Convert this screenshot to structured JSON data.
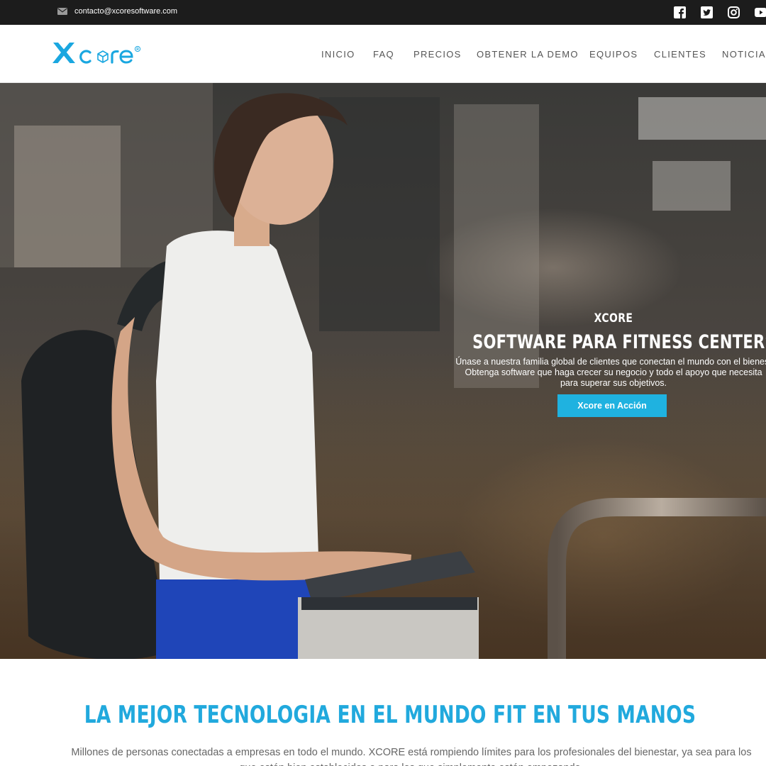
{
  "topbar": {
    "email": "contacto@xcoresoftware.com",
    "icons": [
      "mail-icon",
      "facebook-icon",
      "twitter-icon",
      "instagram-icon",
      "youtube-icon"
    ]
  },
  "brand": {
    "logo_text": "xcore",
    "color": "#1aa7e0"
  },
  "nav": {
    "items": [
      "INICIO",
      "FAQ",
      "PRECIOS",
      "OBTENER LA DEMO",
      "EQUIPOS",
      "CLIENTES",
      "NOTICIAS"
    ]
  },
  "hero": {
    "eyebrow": "XCORE",
    "title": "SOFTWARE PARA FITNESS CENTERS",
    "desc_line1": "Únase a nuestra familia global de clientes que conectan el mundo con el bienest",
    "desc_line2": "Obtenga software que haga crecer su negocio y todo el apoyo que necesita",
    "desc_line3": "para superar sus objetivos.",
    "cta": "Xcore en Acción",
    "accent": "#1fb2e0"
  },
  "section": {
    "title": "LA MEJOR TECNOLOGIA EN EL MUNDO FIT EN TUS MANOS",
    "body": "Millones de personas conectadas a empresas en todo el mundo. XCORE está rompiendo límites para los profesionales del bienestar, ya sea para los que están bien establecidos o para los que simplemente están empezando.",
    "accent": "#21a9dd"
  }
}
